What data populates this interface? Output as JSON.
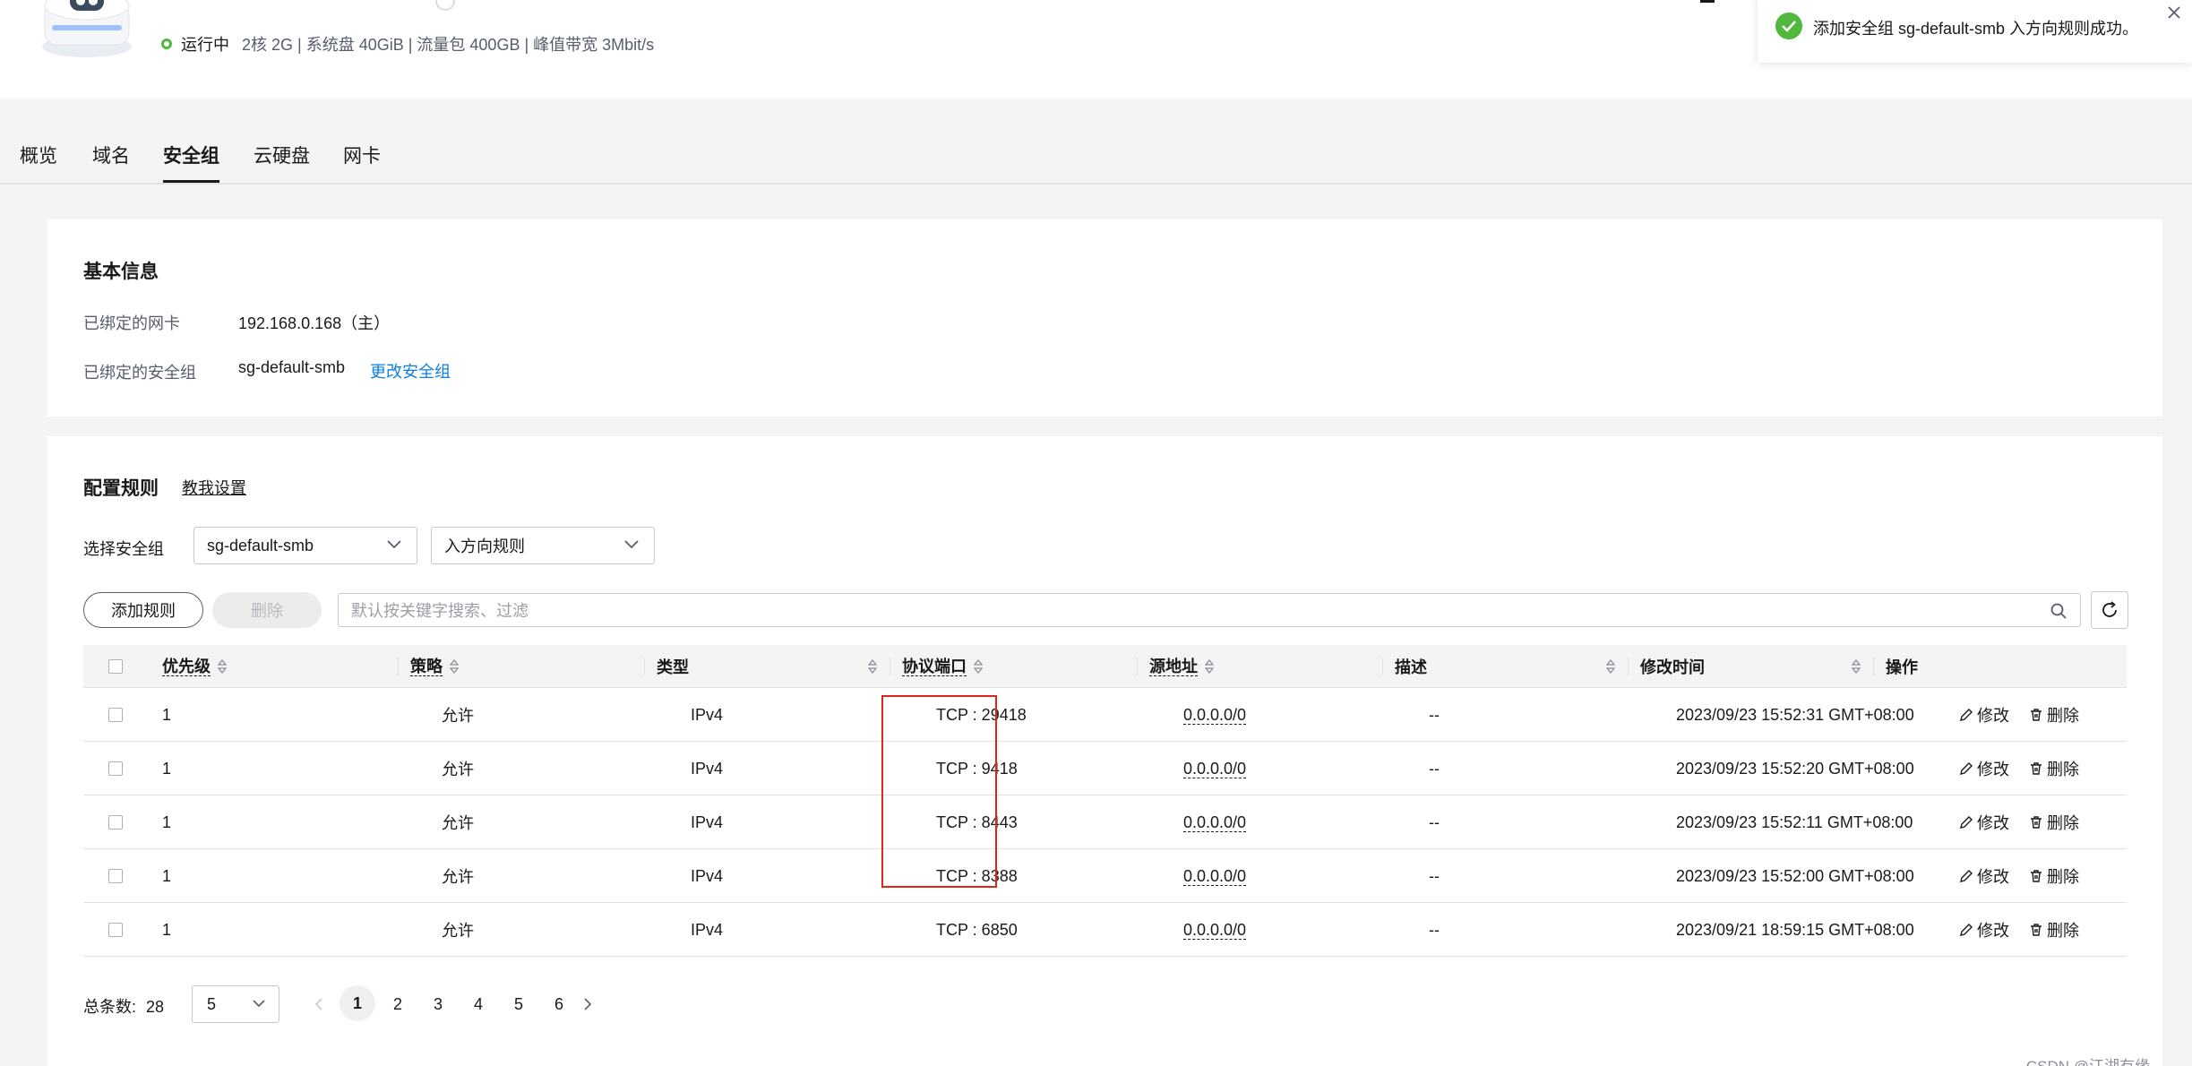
{
  "header": {
    "server_name": "",
    "status": "运行中",
    "specs": "2核  2G | 系统盘 40GiB | 流量包 400GB | 峰值带宽 3Mbit/s"
  },
  "toast": {
    "message": "添加安全组 sg-default-smb 入方向规则成功。",
    "icon": "check-circle-icon",
    "color": "#50b83c"
  },
  "tabs": [
    {
      "label": "概览"
    },
    {
      "label": "域名"
    },
    {
      "label": "安全组",
      "active": true
    },
    {
      "label": "云硬盘"
    },
    {
      "label": "网卡"
    }
  ],
  "basic_info": {
    "title": "基本信息",
    "nic_label": "已绑定的网卡",
    "nic_value": "192.168.0.168（主）",
    "sg_label": "已绑定的安全组",
    "sg_value": "sg-default-smb",
    "change_sg_link": "更改安全组"
  },
  "rules": {
    "title": "配置规则",
    "help_link": "教我设置",
    "select_sg_label": "选择安全组",
    "sg_select_value": "sg-default-smb",
    "direction_select_value": "入方向规则",
    "add_button": "添加规则",
    "delete_button": "删除",
    "search_placeholder": "默认按关键字搜索、过滤",
    "columns": {
      "priority": "优先级",
      "policy": "策略",
      "type": "类型",
      "port": "协议端口",
      "source": "源地址",
      "description": "描述",
      "modified": "修改时间",
      "actions": "操作"
    },
    "rows": [
      {
        "priority": "1",
        "policy": "允许",
        "type": "IPv4",
        "port": "TCP : 29418",
        "source": "0.0.0.0/0",
        "description": "--",
        "modified": "2023/09/23 15:52:31 GMT+08:00",
        "edit": "修改",
        "delete": "删除"
      },
      {
        "priority": "1",
        "policy": "允许",
        "type": "IPv4",
        "port": "TCP : 9418",
        "source": "0.0.0.0/0",
        "description": "--",
        "modified": "2023/09/23 15:52:20 GMT+08:00",
        "edit": "修改",
        "delete": "删除"
      },
      {
        "priority": "1",
        "policy": "允许",
        "type": "IPv4",
        "port": "TCP : 8443",
        "source": "0.0.0.0/0",
        "description": "--",
        "modified": "2023/09/23 15:52:11 GMT+08:00",
        "edit": "修改",
        "delete": "删除"
      },
      {
        "priority": "1",
        "policy": "允许",
        "type": "IPv4",
        "port": "TCP : 8388",
        "source": "0.0.0.0/0",
        "description": "--",
        "modified": "2023/09/23 15:52:00 GMT+08:00",
        "edit": "修改",
        "delete": "删除"
      },
      {
        "priority": "1",
        "policy": "允许",
        "type": "IPv4",
        "port": "TCP : 6850",
        "source": "0.0.0.0/0",
        "description": "--",
        "modified": "2023/09/21 18:59:15 GMT+08:00",
        "edit": "修改",
        "delete": "删除"
      }
    ],
    "highlight_color": "#e0241b"
  },
  "pagination": {
    "total_label": "总条数:",
    "total": "28",
    "page_size": "5",
    "pages": [
      "1",
      "2",
      "3",
      "4",
      "5",
      "6"
    ],
    "current_page": "1"
  },
  "watermark": "CSDN @江湖有缘"
}
